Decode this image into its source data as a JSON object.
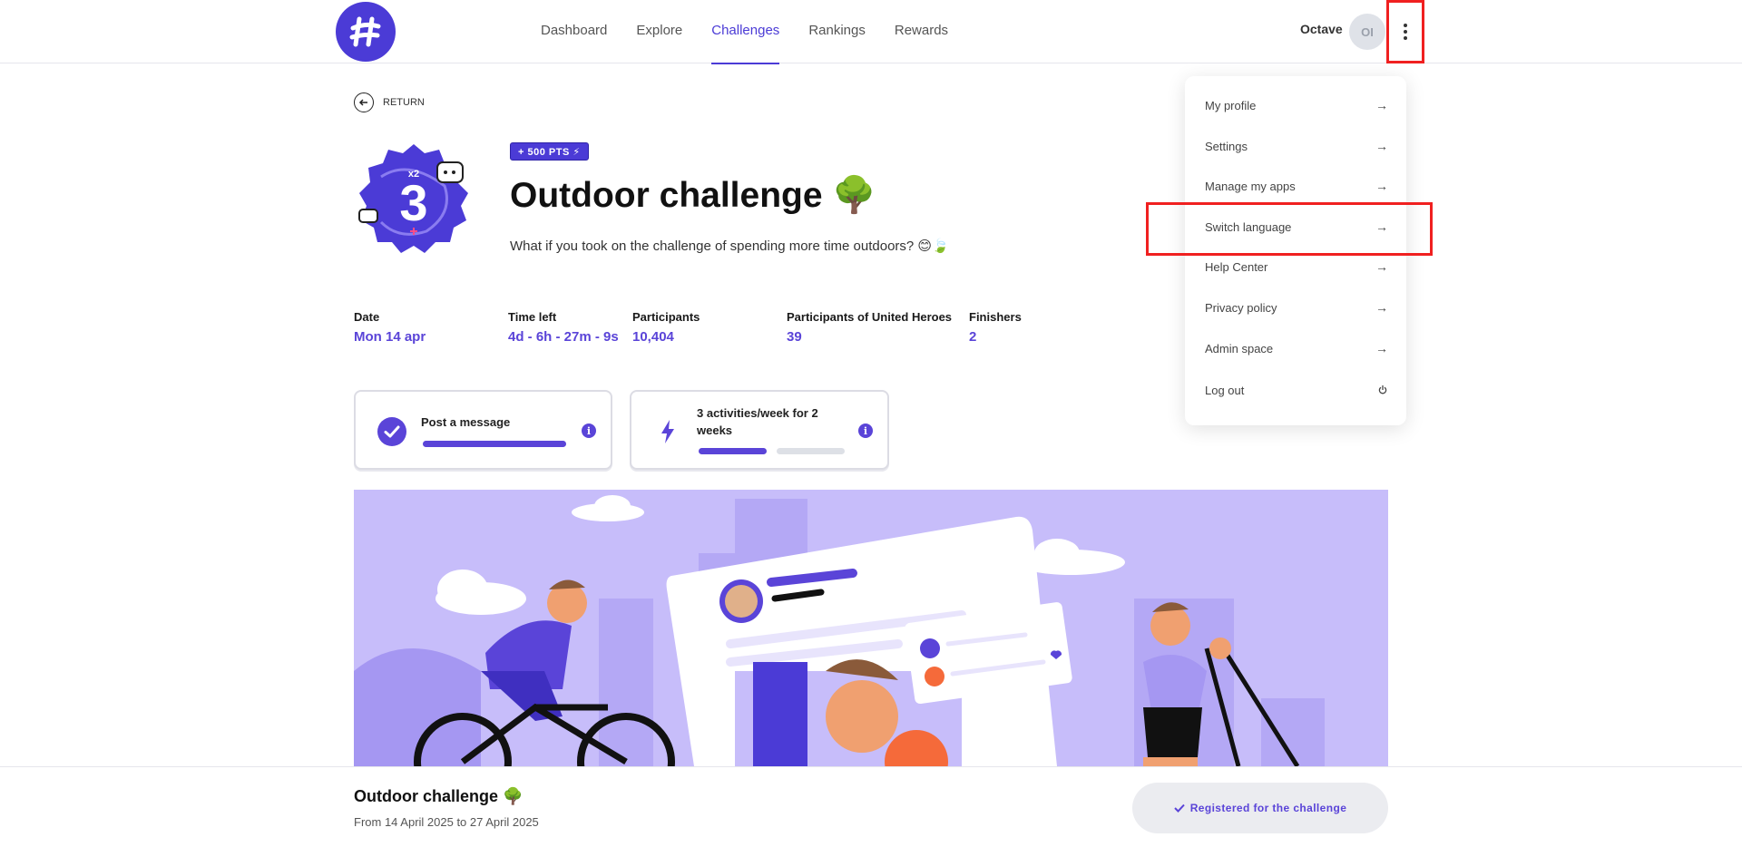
{
  "nav": {
    "items": [
      {
        "label": "Dashboard",
        "active": false
      },
      {
        "label": "Explore",
        "active": false
      },
      {
        "label": "Challenges",
        "active": true
      },
      {
        "label": "Rankings",
        "active": false
      },
      {
        "label": "Rewards",
        "active": false
      }
    ]
  },
  "user": {
    "name": "Octave",
    "initials": "OI"
  },
  "return_label": "RETURN",
  "challenge": {
    "points": "+ 500 PTS ⚡",
    "title": "Outdoor challenge 🌳",
    "description": "What if you took on the challenge of spending more time outdoors? 😊🍃",
    "badge_number": "3",
    "badge_multiplier": "x2"
  },
  "stats": [
    {
      "label": "Date",
      "value": "Mon 14 apr"
    },
    {
      "label": "Time left",
      "value": "4d - 6h - 27m - 9s"
    },
    {
      "label": "Participants",
      "value": "10,404"
    },
    {
      "label": "Participants of United Heroes",
      "value": "39"
    },
    {
      "label": "Finishers",
      "value": "2"
    }
  ],
  "goals": [
    {
      "text": "Post a message",
      "icon": "check-circle-icon",
      "progress": 1.0
    },
    {
      "text": "3 activities/week for 2 weeks",
      "icon": "lightning-icon",
      "progress": 0.5
    }
  ],
  "bottom": {
    "title": "Outdoor challenge 🌳",
    "dates": "From 14 April 2025 to 27 April 2025",
    "registered_label": "Registered for the challenge"
  },
  "menu": {
    "items": [
      {
        "label": "My profile",
        "icon": "arrow-right-icon"
      },
      {
        "label": "Settings",
        "icon": "arrow-right-icon"
      },
      {
        "label": "Manage my apps",
        "icon": "arrow-right-icon"
      },
      {
        "label": "Switch language",
        "icon": "arrow-right-icon"
      },
      {
        "label": "Help Center",
        "icon": "arrow-right-icon"
      },
      {
        "label": "Privacy policy",
        "icon": "arrow-right-icon"
      },
      {
        "label": "Admin space",
        "icon": "arrow-right-icon"
      },
      {
        "label": "Log out",
        "icon": "power-icon"
      }
    ]
  },
  "colors": {
    "accent": "#4b3bd6",
    "highlight": "#f02020"
  }
}
